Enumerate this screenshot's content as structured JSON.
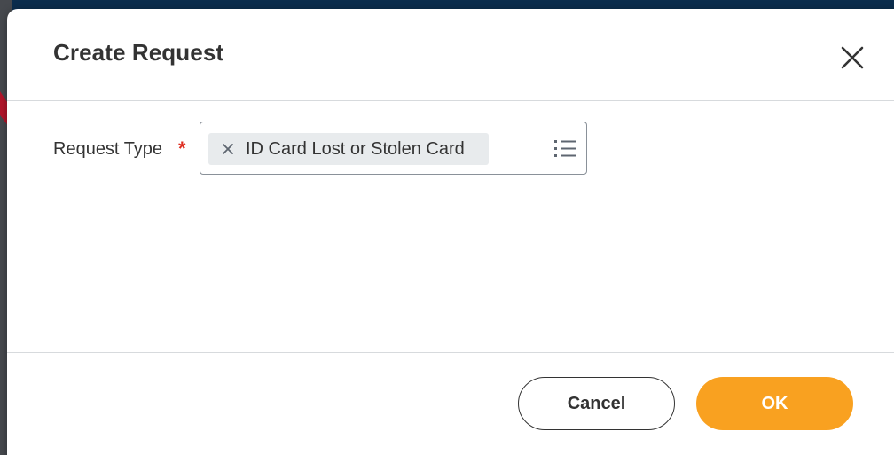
{
  "dialog": {
    "title": "Create Request",
    "close_icon": "close-icon"
  },
  "form": {
    "field_label": "Request Type",
    "required_marker": "*",
    "selected_item": "ID Card Lost or Stolen Card",
    "remove_icon": "x-icon",
    "list_icon": "list-icon"
  },
  "footer": {
    "cancel_label": "Cancel",
    "ok_label": "OK"
  },
  "colors": {
    "primary_button": "#f9a120",
    "required": "#de2e21",
    "annotation_arrow": "#b3152a"
  }
}
